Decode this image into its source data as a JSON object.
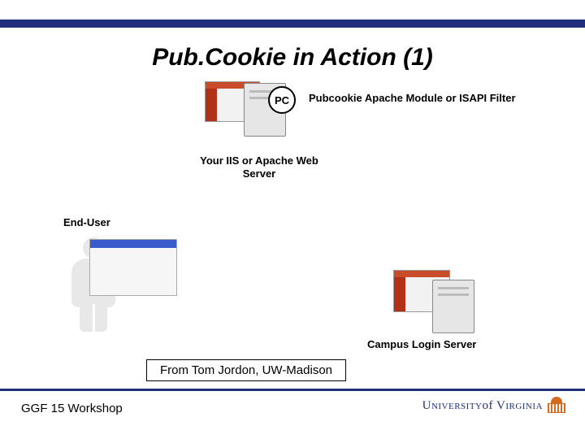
{
  "title": "Pub.Cookie in Action (1)",
  "badge": "PC",
  "pc_label": "Pubcookie Apache Module or ISAPI Filter",
  "server_top_label": "Your IIS or Apache Web Server",
  "enduser_label": "End-User",
  "login_server_label": "Campus Login Server",
  "credit": "From Tom Jordon, UW-Madison",
  "footer_left": "GGF 15 Workshop",
  "uva": {
    "prefix": "U",
    "small1": "NIVERSITY",
    "mid": "of V",
    "small2": "IRGINIA"
  }
}
